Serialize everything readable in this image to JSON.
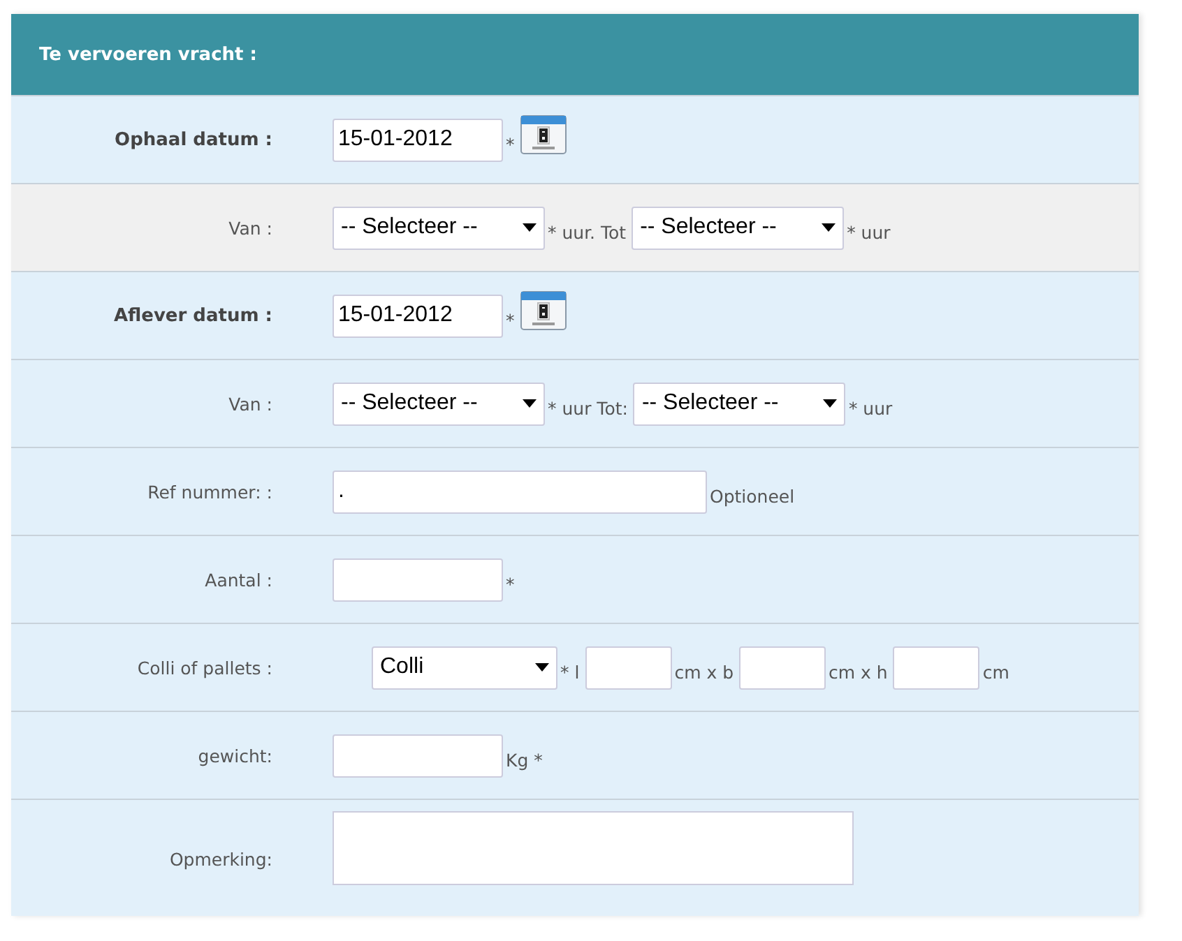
{
  "panel": {
    "title": "Te vervoeren vracht :"
  },
  "rows": [
    {
      "label": "Ophaal datum :",
      "bold": true,
      "highlighted": false,
      "parts": [
        {
          "kind": "date",
          "value": "15-01-2012"
        },
        {
          "kind": "note",
          "text": "*"
        },
        {
          "kind": "calendar"
        }
      ]
    },
    {
      "label": "Van :",
      "bold": false,
      "highlighted": true,
      "parts": [
        {
          "kind": "select",
          "value": "-- Selecteer --"
        },
        {
          "kind": "note",
          "text": "* uur. Tot"
        },
        {
          "kind": "select",
          "value": "-- Selecteer --"
        },
        {
          "kind": "note",
          "text": "* uur"
        }
      ]
    },
    {
      "label": "Aflever datum :",
      "bold": true,
      "highlighted": false,
      "parts": [
        {
          "kind": "date",
          "value": "15-01-2012"
        },
        {
          "kind": "note",
          "text": "*"
        },
        {
          "kind": "calendar"
        }
      ]
    },
    {
      "label": "Van :",
      "bold": false,
      "highlighted": false,
      "parts": [
        {
          "kind": "select",
          "value": "-- Selecteer --"
        },
        {
          "kind": "note",
          "text": "* uur Tot:"
        },
        {
          "kind": "select",
          "value": "-- Selecteer --"
        },
        {
          "kind": "note",
          "text": "* uur"
        }
      ]
    },
    {
      "label": "Ref nummer: :",
      "bold": false,
      "highlighted": false,
      "parts": [
        {
          "kind": "wide",
          "value": "."
        },
        {
          "kind": "note",
          "text": "Optioneel"
        }
      ]
    },
    {
      "label": "Aantal :",
      "bold": false,
      "highlighted": false,
      "parts": [
        {
          "kind": "text"
        },
        {
          "kind": "note",
          "text": "*"
        }
      ]
    },
    {
      "label": "Colli of pallets :",
      "bold": false,
      "highlighted": false,
      "parts": [
        {
          "kind": "typeselect",
          "value": "Colli"
        },
        {
          "kind": "note",
          "text": "* l"
        },
        {
          "kind": "short"
        },
        {
          "kind": "note",
          "text": "cm x b"
        },
        {
          "kind": "short"
        },
        {
          "kind": "note",
          "text": "cm x h"
        },
        {
          "kind": "short"
        },
        {
          "kind": "note",
          "text": "cm"
        }
      ]
    },
    {
      "label": "gewicht:",
      "bold": false,
      "highlighted": false,
      "parts": [
        {
          "kind": "text"
        },
        {
          "kind": "note",
          "text": "Kg *"
        }
      ]
    },
    {
      "label": "Opmerking:",
      "bold": false,
      "highlighted": false,
      "parts": [
        {
          "kind": "textarea"
        }
      ]
    }
  ]
}
